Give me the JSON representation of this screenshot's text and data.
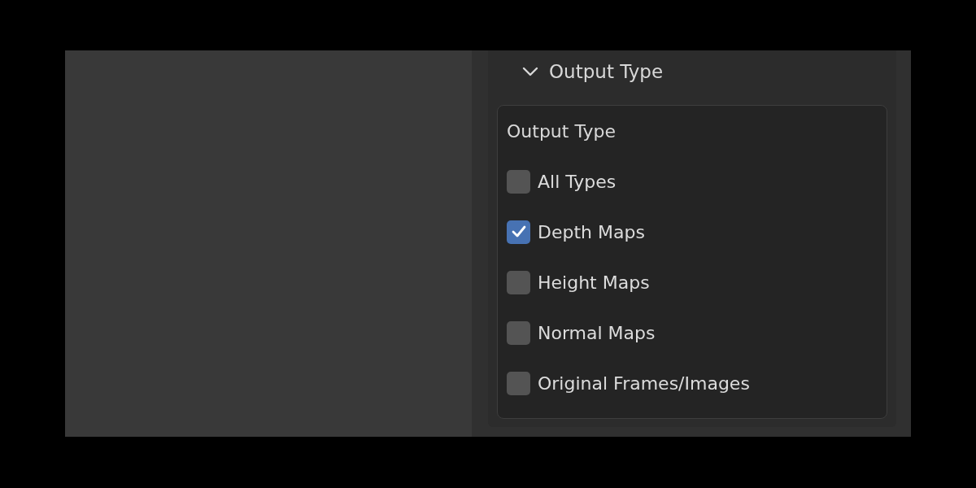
{
  "panel": {
    "title": "Output Type",
    "expanded": true
  },
  "group": {
    "title": "Output Type"
  },
  "options": [
    {
      "label": "All Types",
      "checked": false
    },
    {
      "label": "Depth Maps",
      "checked": true
    },
    {
      "label": "Height Maps",
      "checked": false
    },
    {
      "label": "Normal Maps",
      "checked": false
    },
    {
      "label": "Original Frames/Images",
      "checked": false
    }
  ]
}
